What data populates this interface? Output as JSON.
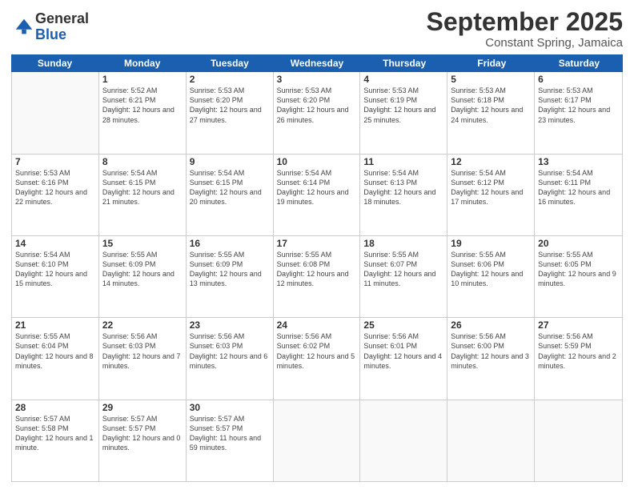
{
  "logo": {
    "general": "General",
    "blue": "Blue"
  },
  "header": {
    "month": "September 2025",
    "location": "Constant Spring, Jamaica"
  },
  "days_of_week": [
    "Sunday",
    "Monday",
    "Tuesday",
    "Wednesday",
    "Thursday",
    "Friday",
    "Saturday"
  ],
  "weeks": [
    [
      {
        "num": "",
        "sunrise": "",
        "sunset": "",
        "daylight": ""
      },
      {
        "num": "1",
        "sunrise": "Sunrise: 5:52 AM",
        "sunset": "Sunset: 6:21 PM",
        "daylight": "Daylight: 12 hours and 28 minutes."
      },
      {
        "num": "2",
        "sunrise": "Sunrise: 5:53 AM",
        "sunset": "Sunset: 6:20 PM",
        "daylight": "Daylight: 12 hours and 27 minutes."
      },
      {
        "num": "3",
        "sunrise": "Sunrise: 5:53 AM",
        "sunset": "Sunset: 6:20 PM",
        "daylight": "Daylight: 12 hours and 26 minutes."
      },
      {
        "num": "4",
        "sunrise": "Sunrise: 5:53 AM",
        "sunset": "Sunset: 6:19 PM",
        "daylight": "Daylight: 12 hours and 25 minutes."
      },
      {
        "num": "5",
        "sunrise": "Sunrise: 5:53 AM",
        "sunset": "Sunset: 6:18 PM",
        "daylight": "Daylight: 12 hours and 24 minutes."
      },
      {
        "num": "6",
        "sunrise": "Sunrise: 5:53 AM",
        "sunset": "Sunset: 6:17 PM",
        "daylight": "Daylight: 12 hours and 23 minutes."
      }
    ],
    [
      {
        "num": "7",
        "sunrise": "Sunrise: 5:53 AM",
        "sunset": "Sunset: 6:16 PM",
        "daylight": "Daylight: 12 hours and 22 minutes."
      },
      {
        "num": "8",
        "sunrise": "Sunrise: 5:54 AM",
        "sunset": "Sunset: 6:15 PM",
        "daylight": "Daylight: 12 hours and 21 minutes."
      },
      {
        "num": "9",
        "sunrise": "Sunrise: 5:54 AM",
        "sunset": "Sunset: 6:15 PM",
        "daylight": "Daylight: 12 hours and 20 minutes."
      },
      {
        "num": "10",
        "sunrise": "Sunrise: 5:54 AM",
        "sunset": "Sunset: 6:14 PM",
        "daylight": "Daylight: 12 hours and 19 minutes."
      },
      {
        "num": "11",
        "sunrise": "Sunrise: 5:54 AM",
        "sunset": "Sunset: 6:13 PM",
        "daylight": "Daylight: 12 hours and 18 minutes."
      },
      {
        "num": "12",
        "sunrise": "Sunrise: 5:54 AM",
        "sunset": "Sunset: 6:12 PM",
        "daylight": "Daylight: 12 hours and 17 minutes."
      },
      {
        "num": "13",
        "sunrise": "Sunrise: 5:54 AM",
        "sunset": "Sunset: 6:11 PM",
        "daylight": "Daylight: 12 hours and 16 minutes."
      }
    ],
    [
      {
        "num": "14",
        "sunrise": "Sunrise: 5:54 AM",
        "sunset": "Sunset: 6:10 PM",
        "daylight": "Daylight: 12 hours and 15 minutes."
      },
      {
        "num": "15",
        "sunrise": "Sunrise: 5:55 AM",
        "sunset": "Sunset: 6:09 PM",
        "daylight": "Daylight: 12 hours and 14 minutes."
      },
      {
        "num": "16",
        "sunrise": "Sunrise: 5:55 AM",
        "sunset": "Sunset: 6:09 PM",
        "daylight": "Daylight: 12 hours and 13 minutes."
      },
      {
        "num": "17",
        "sunrise": "Sunrise: 5:55 AM",
        "sunset": "Sunset: 6:08 PM",
        "daylight": "Daylight: 12 hours and 12 minutes."
      },
      {
        "num": "18",
        "sunrise": "Sunrise: 5:55 AM",
        "sunset": "Sunset: 6:07 PM",
        "daylight": "Daylight: 12 hours and 11 minutes."
      },
      {
        "num": "19",
        "sunrise": "Sunrise: 5:55 AM",
        "sunset": "Sunset: 6:06 PM",
        "daylight": "Daylight: 12 hours and 10 minutes."
      },
      {
        "num": "20",
        "sunrise": "Sunrise: 5:55 AM",
        "sunset": "Sunset: 6:05 PM",
        "daylight": "Daylight: 12 hours and 9 minutes."
      }
    ],
    [
      {
        "num": "21",
        "sunrise": "Sunrise: 5:55 AM",
        "sunset": "Sunset: 6:04 PM",
        "daylight": "Daylight: 12 hours and 8 minutes."
      },
      {
        "num": "22",
        "sunrise": "Sunrise: 5:56 AM",
        "sunset": "Sunset: 6:03 PM",
        "daylight": "Daylight: 12 hours and 7 minutes."
      },
      {
        "num": "23",
        "sunrise": "Sunrise: 5:56 AM",
        "sunset": "Sunset: 6:03 PM",
        "daylight": "Daylight: 12 hours and 6 minutes."
      },
      {
        "num": "24",
        "sunrise": "Sunrise: 5:56 AM",
        "sunset": "Sunset: 6:02 PM",
        "daylight": "Daylight: 12 hours and 5 minutes."
      },
      {
        "num": "25",
        "sunrise": "Sunrise: 5:56 AM",
        "sunset": "Sunset: 6:01 PM",
        "daylight": "Daylight: 12 hours and 4 minutes."
      },
      {
        "num": "26",
        "sunrise": "Sunrise: 5:56 AM",
        "sunset": "Sunset: 6:00 PM",
        "daylight": "Daylight: 12 hours and 3 minutes."
      },
      {
        "num": "27",
        "sunrise": "Sunrise: 5:56 AM",
        "sunset": "Sunset: 5:59 PM",
        "daylight": "Daylight: 12 hours and 2 minutes."
      }
    ],
    [
      {
        "num": "28",
        "sunrise": "Sunrise: 5:57 AM",
        "sunset": "Sunset: 5:58 PM",
        "daylight": "Daylight: 12 hours and 1 minute."
      },
      {
        "num": "29",
        "sunrise": "Sunrise: 5:57 AM",
        "sunset": "Sunset: 5:57 PM",
        "daylight": "Daylight: 12 hours and 0 minutes."
      },
      {
        "num": "30",
        "sunrise": "Sunrise: 5:57 AM",
        "sunset": "Sunset: 5:57 PM",
        "daylight": "Daylight: 11 hours and 59 minutes."
      },
      {
        "num": "",
        "sunrise": "",
        "sunset": "",
        "daylight": ""
      },
      {
        "num": "",
        "sunrise": "",
        "sunset": "",
        "daylight": ""
      },
      {
        "num": "",
        "sunrise": "",
        "sunset": "",
        "daylight": ""
      },
      {
        "num": "",
        "sunrise": "",
        "sunset": "",
        "daylight": ""
      }
    ]
  ]
}
